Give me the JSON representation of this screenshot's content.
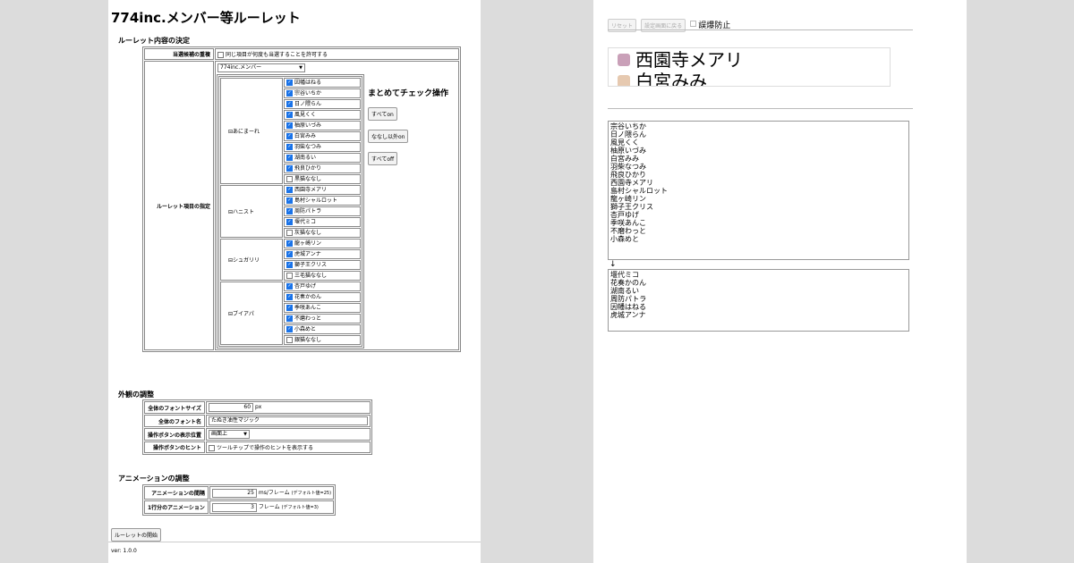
{
  "title": "774inc.メンバー等ルーレット",
  "roulette_section": {
    "title": "ルーレット内容の決定",
    "dup_label": "当選候補の重複",
    "dup_option": "同じ項目が何度も当選することを許可する",
    "items_label": "ルーレット項目の指定",
    "preset_select": "774inc.メンバー",
    "groups": [
      {
        "name": "⊟あにまーれ",
        "members": [
          {
            "label": "因幡はねる",
            "checked": true
          },
          {
            "label": "宗谷いちか",
            "checked": true
          },
          {
            "label": "日ノ隈らん",
            "checked": true
          },
          {
            "label": "風見くく",
            "checked": true
          },
          {
            "label": "柚原いづみ",
            "checked": true
          },
          {
            "label": "白宮みみ",
            "checked": true
          },
          {
            "label": "羽柴なつみ",
            "checked": true
          },
          {
            "label": "湖南るい",
            "checked": true
          },
          {
            "label": "飛良ひかり",
            "checked": true
          },
          {
            "label": "黒猫ななし",
            "checked": false
          }
        ]
      },
      {
        "name": "⊟ハニスト",
        "members": [
          {
            "label": "西園寺メアリ",
            "checked": true
          },
          {
            "label": "島村シャルロット",
            "checked": true
          },
          {
            "label": "周防パトラ",
            "checked": true
          },
          {
            "label": "堰代ミコ",
            "checked": true
          },
          {
            "label": "灰猫ななし",
            "checked": false
          }
        ]
      },
      {
        "name": "⊟シュガリリ",
        "members": [
          {
            "label": "龍ヶ崎リン",
            "checked": true
          },
          {
            "label": "虎城アンナ",
            "checked": true
          },
          {
            "label": "獅子王クリス",
            "checked": true
          },
          {
            "label": "三毛猫ななし",
            "checked": false
          }
        ]
      },
      {
        "name": "⊟ブイアパ",
        "members": [
          {
            "label": "杏戸ゆげ",
            "checked": true
          },
          {
            "label": "花奏かのん",
            "checked": true
          },
          {
            "label": "季咲あんこ",
            "checked": true
          },
          {
            "label": "不磨わっと",
            "checked": true
          },
          {
            "label": "小森めと",
            "checked": true
          },
          {
            "label": "銀猫ななし",
            "checked": false
          }
        ]
      }
    ],
    "bulk_title": "まとめてチェック操作",
    "bulk_all_on": "すべてon",
    "bulk_except_nanashi": "ななし以外on",
    "bulk_all_off": "すべてoff"
  },
  "appearance_section": {
    "title": "外観の調整",
    "font_size_label": "全体のフォントサイズ",
    "font_size_value": "60",
    "font_size_unit": "px",
    "font_name_label": "全体のフォント名",
    "font_name_value": "たぬき油性マジック",
    "button_pos_label": "操作ボタンの表示位置",
    "button_pos_value": "画面上",
    "button_hint_label": "操作ボタンのヒント",
    "button_hint_option": "ツールチップで操作のヒントを表示する"
  },
  "animation_section": {
    "title": "アニメーションの調整",
    "interval_label": "アニメーションの間隔",
    "interval_value": "25",
    "interval_unit": "ms/フレーム",
    "interval_default": "(デフォルト値=25)",
    "per_row_label": "1行分のアニメーション",
    "per_row_value": "3",
    "per_row_unit": "フレーム",
    "per_row_default": "(デフォルト値=3)"
  },
  "start_button": "ルーレットの開始",
  "version": "ver: 1.0.0",
  "right": {
    "reset_button": "リセット",
    "back_button": "設定画面に戻る",
    "prevent_label": "誤爆防止",
    "display_row1": "西園寺メアリ",
    "display_row2": "白宮みみ",
    "remaining_list": "宗谷いちか\n日ノ隈らん\n風見くく\n柚原いづみ\n白宮みみ\n羽柴なつみ\n飛良ひかり\n西園寺メアリ\n島村シャルロット\n龍ヶ崎リン\n獅子王クリス\n杏戸ゆげ\n季咲あんこ\n不磨わっと\n小森めと",
    "arrow": "↓",
    "picked_list": "堰代ミコ\n花奏かのん\n湖南るい\n周防パトラ\n因幡はねる\n虎城アンナ"
  }
}
